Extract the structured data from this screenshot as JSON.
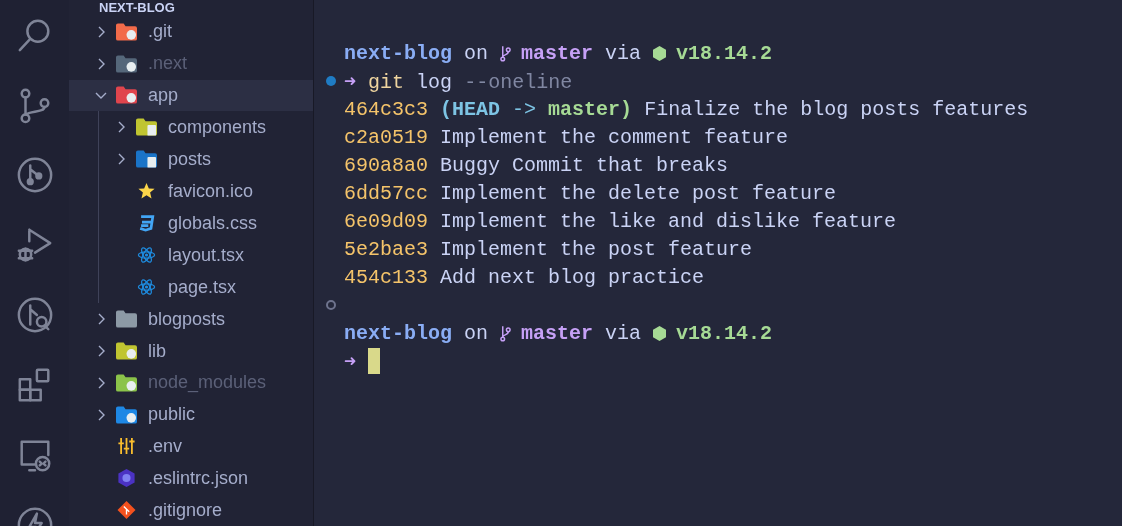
{
  "explorer": {
    "title": "NEXT-BLOG",
    "items": [
      {
        "name": ".git",
        "kind": "folder",
        "color": "#f26b4a",
        "expanded": false,
        "dimmed": false,
        "selected": false
      },
      {
        "name": ".next",
        "kind": "folder",
        "color": "#55677a",
        "expanded": false,
        "dimmed": true,
        "selected": false
      },
      {
        "name": "app",
        "kind": "folder",
        "color": "#e0454d",
        "expanded": true,
        "dimmed": false,
        "selected": true,
        "children": [
          {
            "name": "components",
            "kind": "folder",
            "color": "#c0c531",
            "expanded": false,
            "dimmed": false,
            "selected": false
          },
          {
            "name": "posts",
            "kind": "folder",
            "color": "#1a74c8",
            "expanded": false,
            "dimmed": false,
            "selected": false
          },
          {
            "name": "favicon.ico",
            "kind": "star",
            "dimmed": false,
            "selected": false
          },
          {
            "name": "globals.css",
            "kind": "css",
            "dimmed": false,
            "selected": false
          },
          {
            "name": "layout.tsx",
            "kind": "react",
            "dimmed": false,
            "selected": false
          },
          {
            "name": "page.tsx",
            "kind": "react",
            "dimmed": false,
            "selected": false
          }
        ]
      },
      {
        "name": "blogposts",
        "kind": "plainfolder",
        "color": "#8d9aa6",
        "expanded": false,
        "dimmed": false,
        "selected": false
      },
      {
        "name": "lib",
        "kind": "folder",
        "color": "#c0c531",
        "expanded": false,
        "dimmed": false,
        "selected": false
      },
      {
        "name": "node_modules",
        "kind": "folder",
        "color": "#8bc34a",
        "expanded": false,
        "dimmed": true,
        "selected": false
      },
      {
        "name": "public",
        "kind": "folder",
        "color": "#1e88e5",
        "expanded": false,
        "dimmed": false,
        "selected": false
      },
      {
        "name": ".env",
        "kind": "sliders",
        "dimmed": false,
        "selected": false
      },
      {
        "name": ".eslintrc.json",
        "kind": "hexagon",
        "dimmed": false,
        "selected": false
      },
      {
        "name": ".gitignore",
        "kind": "gitdiamond",
        "dimmed": false,
        "selected": false
      }
    ]
  },
  "terminal": {
    "lines": [
      {
        "kind": "prompt",
        "dir": "next-blog",
        "on": "on",
        "branch": "master",
        "via": "via",
        "version": "v18.14.2"
      },
      {
        "kind": "command",
        "succeeded": true,
        "arrow": "➜",
        "segments": [
          {
            "kind": "program",
            "text": "git"
          },
          {
            "kind": "arg",
            "text": "log"
          },
          {
            "kind": "flag",
            "text": "--oneline"
          }
        ]
      },
      {
        "kind": "output",
        "segments": [
          {
            "kind": "hash",
            "text": "464c3c3"
          },
          {
            "kind": "paren",
            "text": "(HEAD"
          },
          {
            "kind": "arrow",
            "text": "->"
          },
          {
            "kind": "branch",
            "text": "master)"
          },
          {
            "kind": "message",
            "text": "Finalize the blog posts features"
          }
        ]
      },
      {
        "kind": "output",
        "segments": [
          {
            "kind": "hash",
            "text": "c2a0519"
          },
          {
            "kind": "message",
            "text": "Implement the comment feature"
          }
        ]
      },
      {
        "kind": "output",
        "segments": [
          {
            "kind": "hash",
            "text": "690a8a0"
          },
          {
            "kind": "message",
            "text": "Buggy Commit that breaks"
          }
        ]
      },
      {
        "kind": "output",
        "segments": [
          {
            "kind": "hash",
            "text": "6dd57cc"
          },
          {
            "kind": "message",
            "text": "Implement the delete post feature"
          }
        ]
      },
      {
        "kind": "output",
        "segments": [
          {
            "kind": "hash",
            "text": "6e09d09"
          },
          {
            "kind": "message",
            "text": "Implement the like and dislike feature"
          }
        ]
      },
      {
        "kind": "output",
        "segments": [
          {
            "kind": "hash",
            "text": "5e2bae3"
          },
          {
            "kind": "message",
            "text": "Implement the post feature"
          }
        ]
      },
      {
        "kind": "output",
        "segments": [
          {
            "kind": "hash",
            "text": "454c133"
          },
          {
            "kind": "message",
            "text": "Add next blog practice"
          }
        ]
      },
      {
        "kind": "gap",
        "succeeded": false
      },
      {
        "kind": "prompt",
        "dir": "next-blog",
        "on": "on",
        "branch": "master",
        "via": "via",
        "version": "v18.14.2"
      },
      {
        "kind": "input",
        "arrow": "➜",
        "cursor": true
      }
    ]
  }
}
